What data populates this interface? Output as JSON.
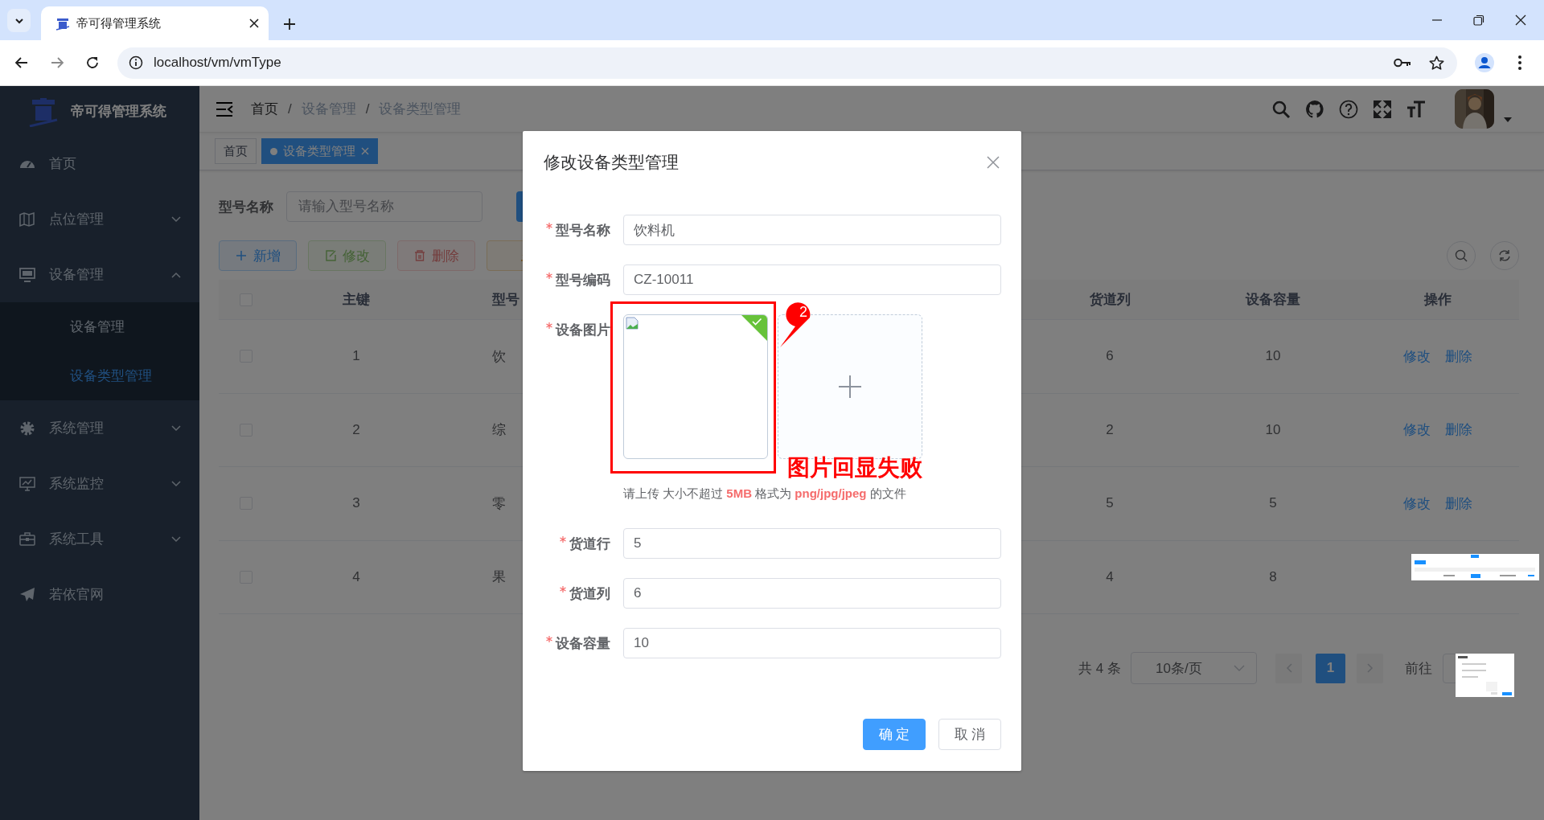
{
  "browser": {
    "tab_title": "帝可得管理系统",
    "url": "localhost/vm/vmType"
  },
  "sidebar": {
    "title": "帝可得管理系统",
    "items": [
      {
        "label": "首页",
        "selected": false
      },
      {
        "label": "点位管理",
        "selected": false,
        "expanded": false
      },
      {
        "label": "设备管理",
        "selected": false,
        "expanded": true,
        "children": [
          {
            "label": "设备管理",
            "selected": false
          },
          {
            "label": "设备类型管理",
            "selected": true
          }
        ]
      },
      {
        "label": "系统管理",
        "selected": false,
        "expanded": false
      },
      {
        "label": "系统监控",
        "selected": false,
        "expanded": false
      },
      {
        "label": "系统工具",
        "selected": false,
        "expanded": false
      },
      {
        "label": "若依官网",
        "selected": false
      }
    ]
  },
  "header": {
    "breadcrumb": [
      "首页",
      "/",
      "设备管理",
      "/",
      "设备类型管理"
    ]
  },
  "tags": [
    {
      "label": "首页",
      "selected": false
    },
    {
      "label": "设备类型管理",
      "selected": true
    }
  ],
  "search": {
    "label": "型号名称",
    "placeholder": "请输入型号名称"
  },
  "toolbar": [
    {
      "kind": "primary",
      "label": "新增",
      "disabled": false
    },
    {
      "kind": "success",
      "label": "修改",
      "disabled": true
    },
    {
      "kind": "danger",
      "label": "删除",
      "disabled": true
    },
    {
      "kind": "warning",
      "disabled": false
    }
  ],
  "table": {
    "all_checked": false,
    "columns": [
      "主键",
      "型号",
      "货道列",
      "设备容量",
      "操作"
    ],
    "rows": [
      {
        "checked": false,
        "cells": [
          "1",
          "饮",
          "6",
          "10"
        ],
        "actions": [
          "修改",
          "删除"
        ]
      },
      {
        "checked": false,
        "cells": [
          "2",
          "综",
          "2",
          "10"
        ],
        "actions": [
          "修改",
          "删除"
        ]
      },
      {
        "checked": false,
        "cells": [
          "3",
          "零",
          "5",
          "5"
        ],
        "actions": [
          "修改",
          "删除"
        ]
      },
      {
        "checked": false,
        "cells": [
          "4",
          "果",
          "4",
          "8"
        ]
      }
    ]
  },
  "pagination": {
    "total": "共 4 条",
    "page_size": "10条/页",
    "pages": [
      {
        "label": "1",
        "selected": true
      }
    ],
    "goto": "前往"
  },
  "dialog": {
    "title": "修改设备类型管理",
    "fields": [
      {
        "kind": "text",
        "label": "型号名称",
        "required": true,
        "value": "饮料机"
      },
      {
        "kind": "text",
        "label": "型号编码",
        "required": true,
        "value": "CZ-10011"
      },
      {
        "kind": "upload",
        "label": "设备图片",
        "required": true,
        "success": true,
        "tip": "请上传 大小不超过 **5MB** 格式为 **png/jpg/jpeg** 的文件"
      },
      {
        "kind": "text",
        "label": "货道行",
        "required": true,
        "value": "5"
      },
      {
        "kind": "text",
        "label": "货道列",
        "required": true,
        "value": "6"
      },
      {
        "kind": "text",
        "label": "设备容量",
        "required": true,
        "value": "10"
      }
    ],
    "buttons": [
      {
        "kind": "primary",
        "label": "确 定"
      },
      {
        "kind": "default",
        "label": "取 消"
      }
    ]
  },
  "annotation": {
    "number": "2",
    "text": "图片回显失败"
  }
}
